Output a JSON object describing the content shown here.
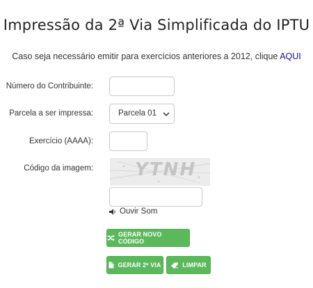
{
  "header": {
    "title": "Impressão da 2ª Via Simplificada do IPTU",
    "subtitle_text": "Caso seja necessário emitir para exercícios anteriores a 2012, clique",
    "subtitle_link": "AQUI"
  },
  "form": {
    "contribuinte_label": "Número do Contribuinte:",
    "contribuinte_value": "",
    "parcela_label": "Parcela a ser impressa:",
    "parcela_selected": "Parcela 01",
    "exercicio_label": "Exercício (AAAA):",
    "exercicio_value": "",
    "codigo_label": "Código da imagem:",
    "captcha_text": "YTNH",
    "codigo_value": "",
    "audio_label": "Ouvir Som"
  },
  "buttons": {
    "novo_codigo": "GERAR NOVO CÓDIGO",
    "gerar_via": "GERAR 2ª VIA",
    "limpar": "LIMPAR"
  },
  "colors": {
    "button_green": "#5cb85c",
    "link_blue": "#1a0dab"
  },
  "icons": {
    "shuffle": "shuffle-icon",
    "document": "document-icon",
    "eraser": "eraser-icon",
    "speaker": "speaker-icon",
    "chevron": "chevron-down-icon"
  }
}
